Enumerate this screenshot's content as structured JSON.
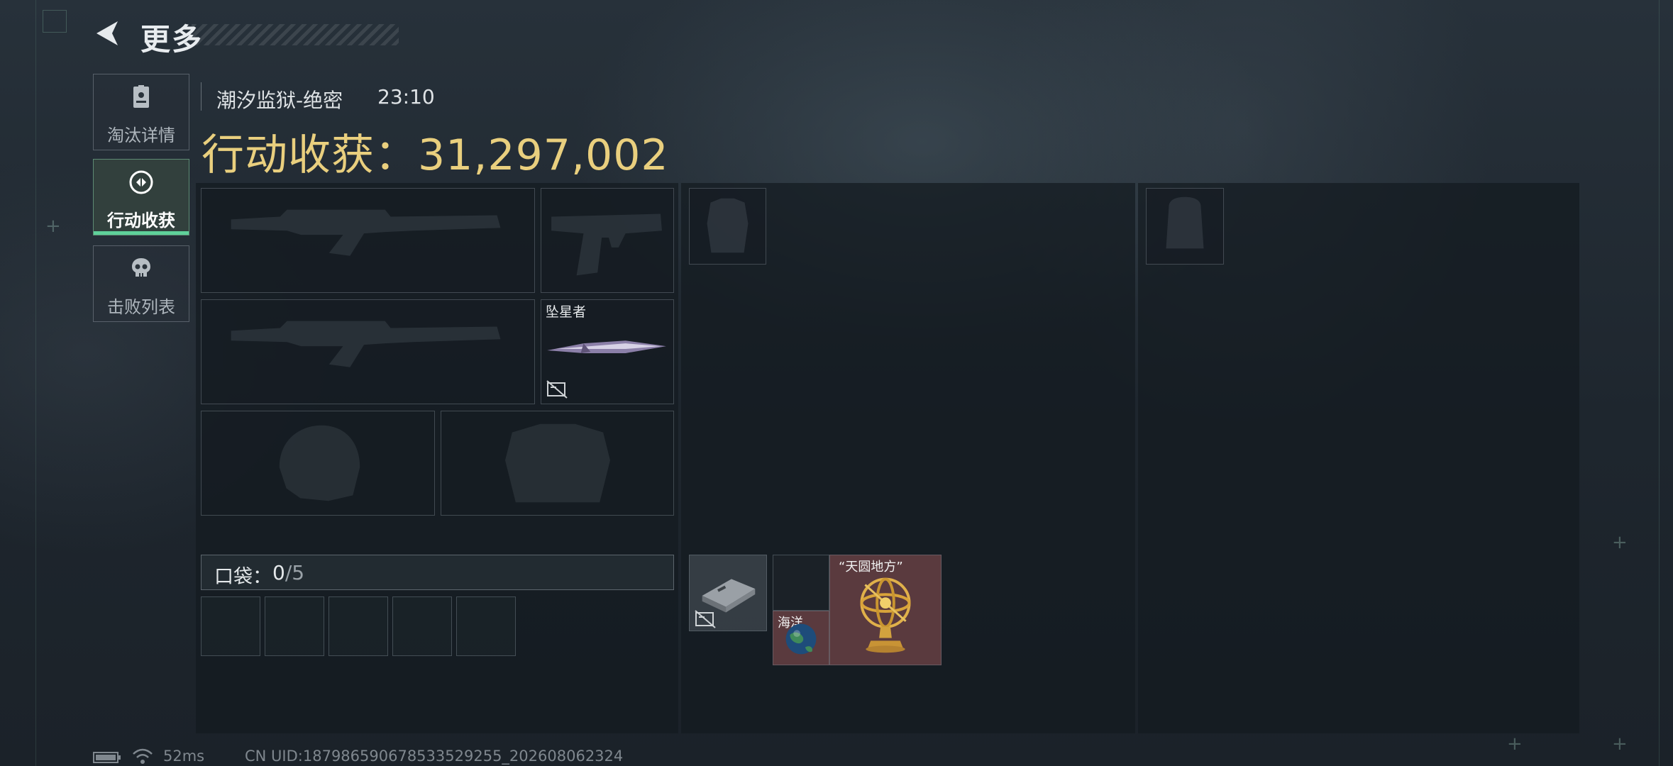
{
  "header": {
    "title": "更多"
  },
  "sidebar": {
    "tabs": [
      {
        "label": "淘汰详情",
        "active": false,
        "icon": "id-card-icon"
      },
      {
        "label": "行动收获",
        "active": true,
        "icon": "loot-icon"
      },
      {
        "label": "击败列表",
        "active": false,
        "icon": "skull-icon"
      }
    ]
  },
  "info": {
    "map": "潮汐监狱-绝密",
    "duration": "23:10",
    "gains_label": "行动收获：",
    "gains_value": "31,297,002"
  },
  "equipment": {
    "melee_name": "坠星者"
  },
  "pocket": {
    "label": "口袋：",
    "used": "0",
    "total": "/5"
  },
  "items": {
    "globe_label": "海洋",
    "armillary_label": "“天圆地方”"
  },
  "footer": {
    "ping": "52ms",
    "uid": "CN UID:187986590678533529255_202608062324"
  },
  "colors": {
    "accent_gold": "#e9cf7e",
    "active_green": "#5fd19a",
    "rare_item_bg": "#5a3a3e"
  }
}
